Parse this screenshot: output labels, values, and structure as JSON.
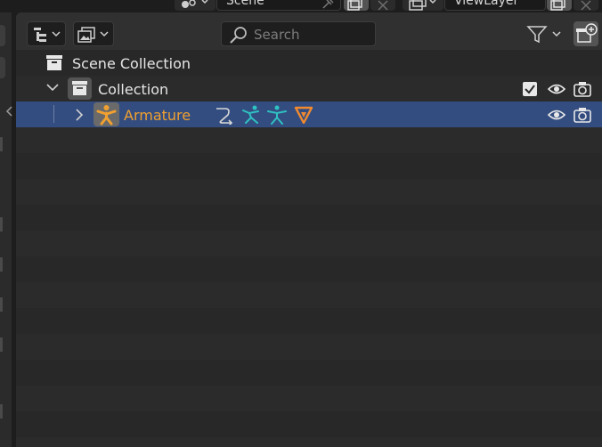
{
  "topbar": {
    "scene_label": "Scene",
    "viewlayer_label": "ViewLayer"
  },
  "outliner": {
    "header": {
      "display_mode_icon": "outliner-view-icon",
      "filter_icon": "funnel-icon",
      "search": {
        "placeholder": "Search",
        "value": ""
      },
      "new_collection_icon": "new-collection-icon"
    },
    "tree": [
      {
        "label": "Scene Collection",
        "icon": "scene-collection-icon",
        "level": 0
      },
      {
        "label": "Collection",
        "icon": "collection-icon",
        "level": 1,
        "expanded": true,
        "checkbox_checked": true,
        "visible": true,
        "renderable": true
      },
      {
        "label": "Armature",
        "icon": "armature-icon",
        "level": 2,
        "expanded": false,
        "selected": true,
        "visible": true,
        "renderable": true,
        "modifiers": [
          "constraint-icon",
          "pose-icon",
          "bone-icon",
          "data-icon"
        ]
      }
    ]
  },
  "colors": {
    "selected_row": "#334d80",
    "armature_text": "#f0a030",
    "bone_icon": "#2fc1c1",
    "data_icon": "#f08a2f"
  }
}
